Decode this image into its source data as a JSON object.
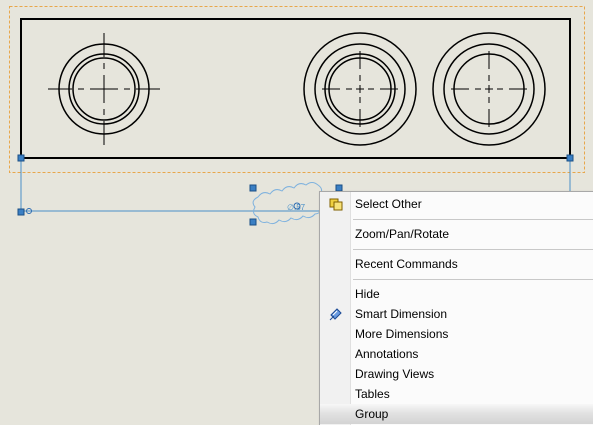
{
  "drawing": {
    "dimension_text": "∅.57"
  },
  "context_menu": {
    "items": [
      {
        "label": "Select Other",
        "icon": "select-other-icon"
      },
      {
        "label": "Zoom/Pan/Rotate"
      },
      {
        "label": "Recent Commands"
      },
      {
        "label": "Hide"
      },
      {
        "label": "Smart Dimension",
        "icon": "smart-dimension-icon"
      },
      {
        "label": "More Dimensions"
      },
      {
        "label": "Annotations"
      },
      {
        "label": "Drawing Views"
      },
      {
        "label": "Tables"
      },
      {
        "label": "Group",
        "highlighted": true
      }
    ]
  }
}
